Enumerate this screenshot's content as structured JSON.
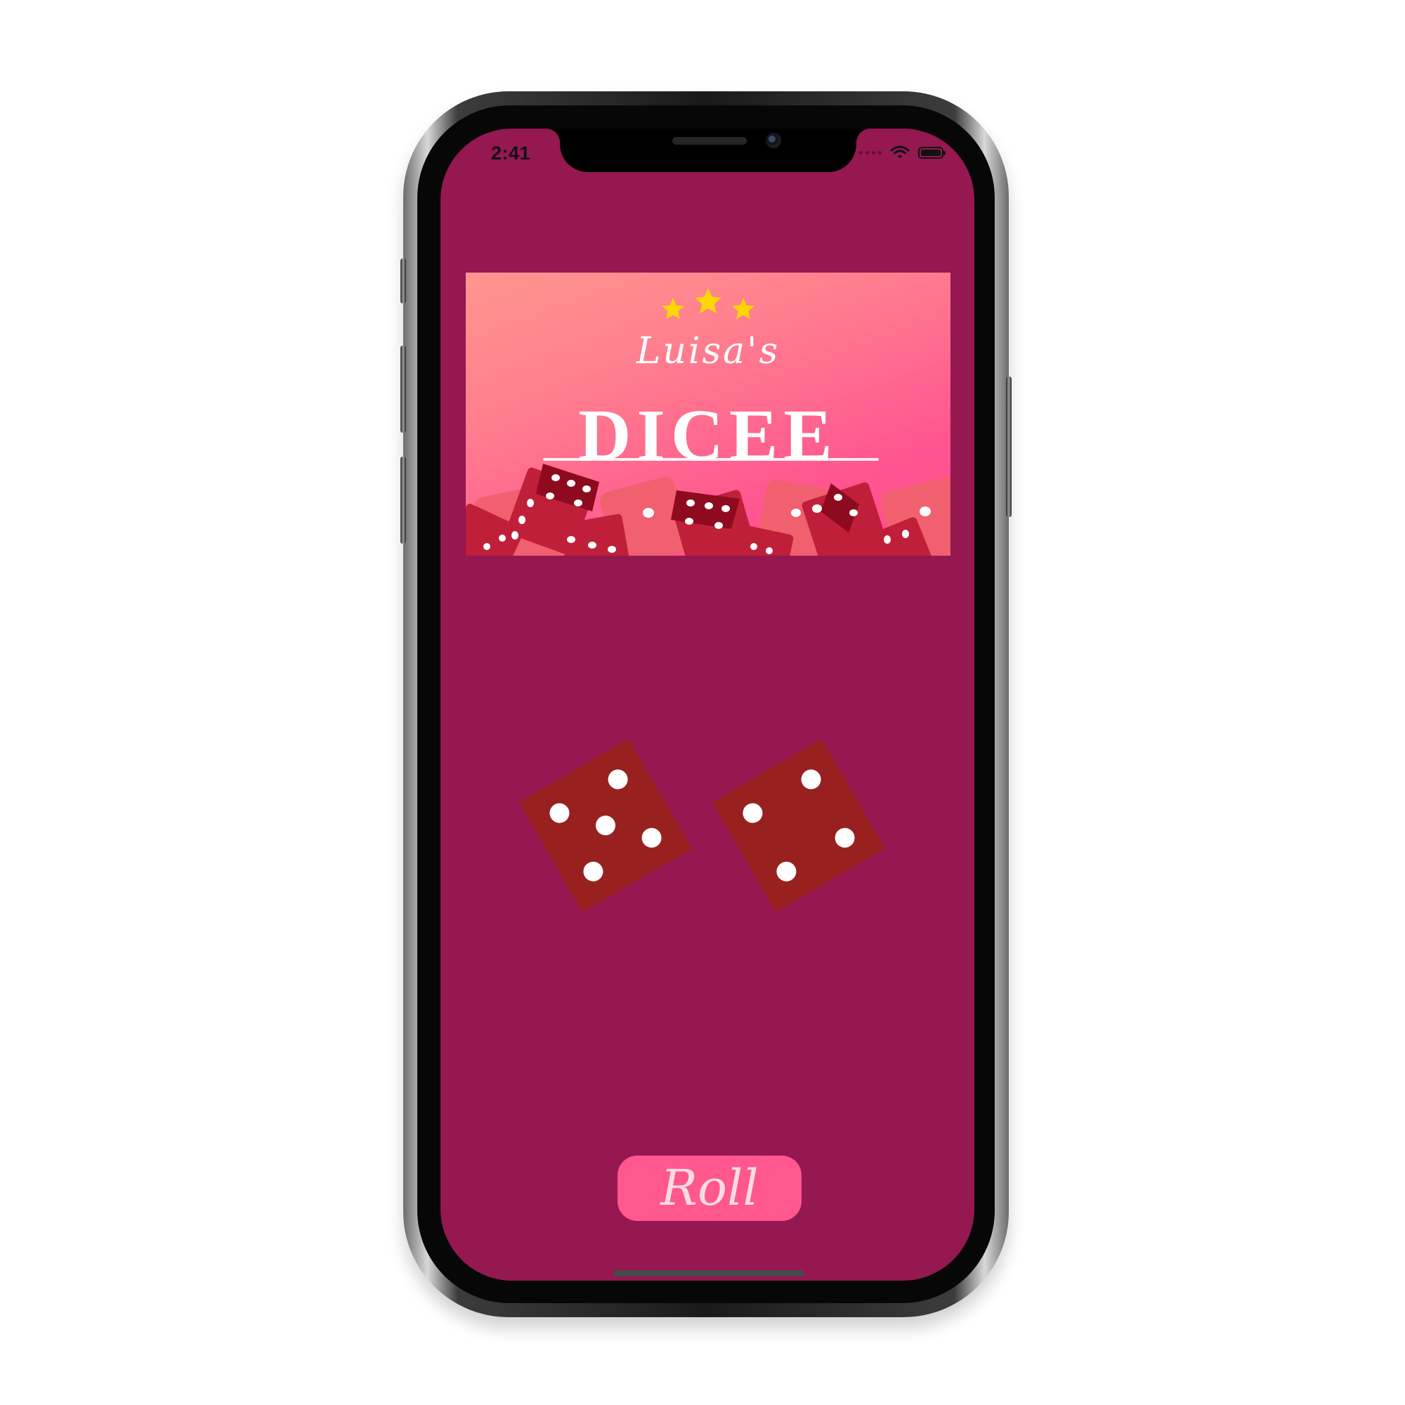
{
  "status_bar": {
    "time": "2:41",
    "icons": [
      "signal-dots-icon",
      "wifi-icon",
      "battery-icon"
    ]
  },
  "logo": {
    "subtitle": "Luisa's",
    "title": "DICEE",
    "star_color": "#ffd600",
    "star_count": 3
  },
  "dice": {
    "left": {
      "value": 5,
      "color": "#98201f"
    },
    "right": {
      "value": 4,
      "color": "#98201f"
    }
  },
  "roll_button": {
    "label": "Roll"
  },
  "colors": {
    "background": "#951850",
    "button": "#ff578e",
    "button_text": "#ffdbe6"
  }
}
